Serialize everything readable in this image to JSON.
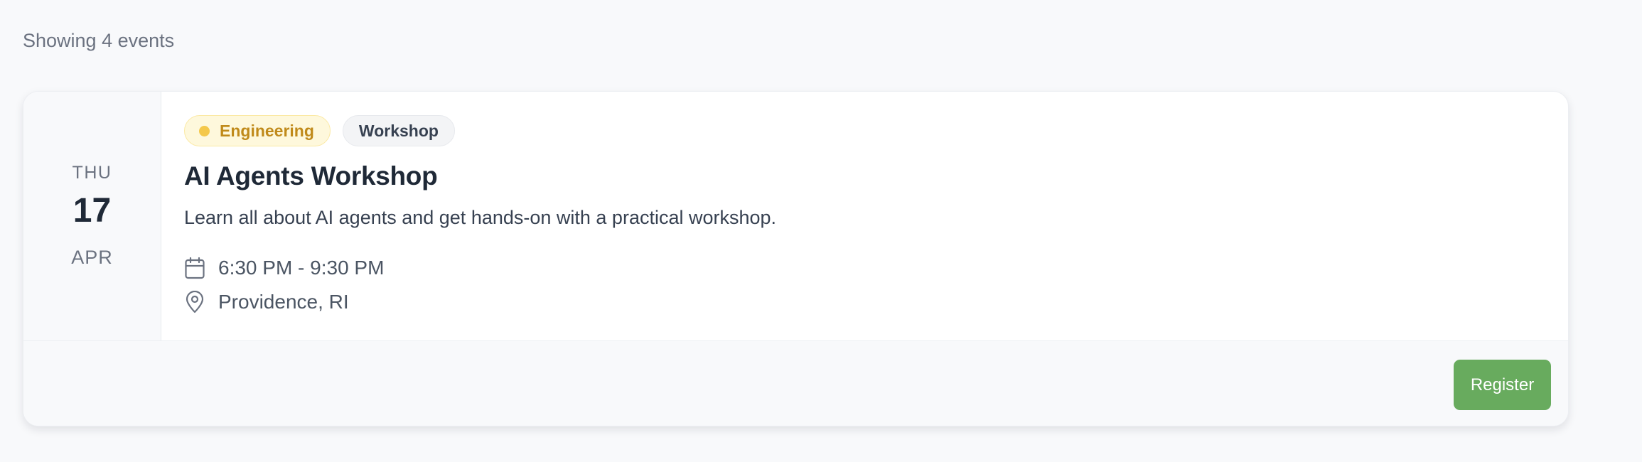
{
  "results": {
    "count_text": "Showing 4 events"
  },
  "event": {
    "date": {
      "weekday": "THU",
      "day": "17",
      "month": "APR"
    },
    "tags": {
      "category": "Engineering",
      "type": "Workshop"
    },
    "title": "AI Agents Workshop",
    "description": "Learn all about AI agents and get hands-on with a practical workshop.",
    "time": "6:30 PM - 9:30 PM",
    "location": "Providence, RI",
    "time_icon": "calendar-icon",
    "location_icon": "map-pin-icon",
    "register_label": "Register"
  },
  "colors": {
    "background": "#f8f9fb",
    "accent": "#68ab5e",
    "category_tag_text": "#c08a1a",
    "category_tag_bg": "#fef8dc",
    "category_dot": "#f4c84b"
  }
}
